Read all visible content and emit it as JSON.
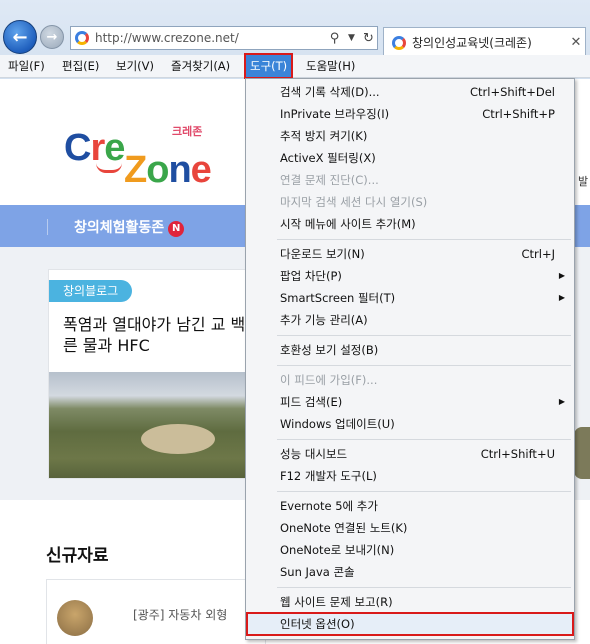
{
  "browser": {
    "address": "http://www.crezone.net/",
    "tab_title": "창의인성교육넷(크레존)",
    "icons": {
      "back": "back-arrow-icon",
      "forward": "forward-arrow-icon",
      "search": "search-icon",
      "dropdown": "chevron-down-icon",
      "refresh": "refresh-icon",
      "close": "close-icon"
    }
  },
  "menubar": {
    "items": [
      "파일(F)",
      "편집(E)",
      "보기(V)",
      "즐겨찾기(A)",
      "도구(T)",
      "도움말(H)"
    ],
    "active": "도구(T)"
  },
  "page": {
    "logo": {
      "cre": "Cre",
      "zone": "Zone",
      "korean": "크레존"
    },
    "right_peek": "발",
    "nav_item": "창의체험활동존",
    "new_badge": "N",
    "card_tag": "창의블로그",
    "card_title": "폭염과 열대야가 남긴 교 백록담의 마른 물과 HFC",
    "section_title": "신규자료",
    "list_item_text": "[광주] 자동차 외형"
  },
  "tools_menu": {
    "groups": [
      [
        {
          "label": "검색 기록 삭제(D)...",
          "shortcut": "Ctrl+Shift+Del"
        },
        {
          "label": "InPrivate 브라우징(I)",
          "shortcut": "Ctrl+Shift+P"
        },
        {
          "label": "추적 방지 켜기(K)"
        },
        {
          "label": "ActiveX 필터링(X)"
        },
        {
          "label": "연결 문제 진단(C)...",
          "disabled": true
        },
        {
          "label": "마지막 검색 세션 다시 열기(S)",
          "disabled": true
        },
        {
          "label": "시작 메뉴에 사이트 추가(M)"
        }
      ],
      [
        {
          "label": "다운로드 보기(N)",
          "shortcut": "Ctrl+J"
        },
        {
          "label": "팝업 차단(P)",
          "submenu": true
        },
        {
          "label": "SmartScreen 필터(T)",
          "submenu": true
        },
        {
          "label": "추가 기능 관리(A)"
        }
      ],
      [
        {
          "label": "호환성 보기 설정(B)"
        }
      ],
      [
        {
          "label": "이 피드에 가입(F)...",
          "disabled": true
        },
        {
          "label": "피드 검색(E)",
          "submenu": true
        },
        {
          "label": "Windows 업데이트(U)"
        }
      ],
      [
        {
          "label": "성능 대시보드",
          "shortcut": "Ctrl+Shift+U"
        },
        {
          "label": "F12 개발자 도구(L)"
        }
      ],
      [
        {
          "label": "Evernote 5에 추가"
        },
        {
          "label": "OneNote 연결된 노트(K)"
        },
        {
          "label": "OneNote로 보내기(N)"
        },
        {
          "label": "Sun Java 콘솔"
        }
      ],
      [
        {
          "label": "웹 사이트 문제 보고(R)"
        },
        {
          "label": "인터넷 옵션(O)",
          "highlighted": true
        }
      ]
    ]
  },
  "colors": {
    "highlight_outline": "#d91a1a",
    "menu_active": "#3a84d8",
    "nav_band": "#7ea3e6"
  }
}
